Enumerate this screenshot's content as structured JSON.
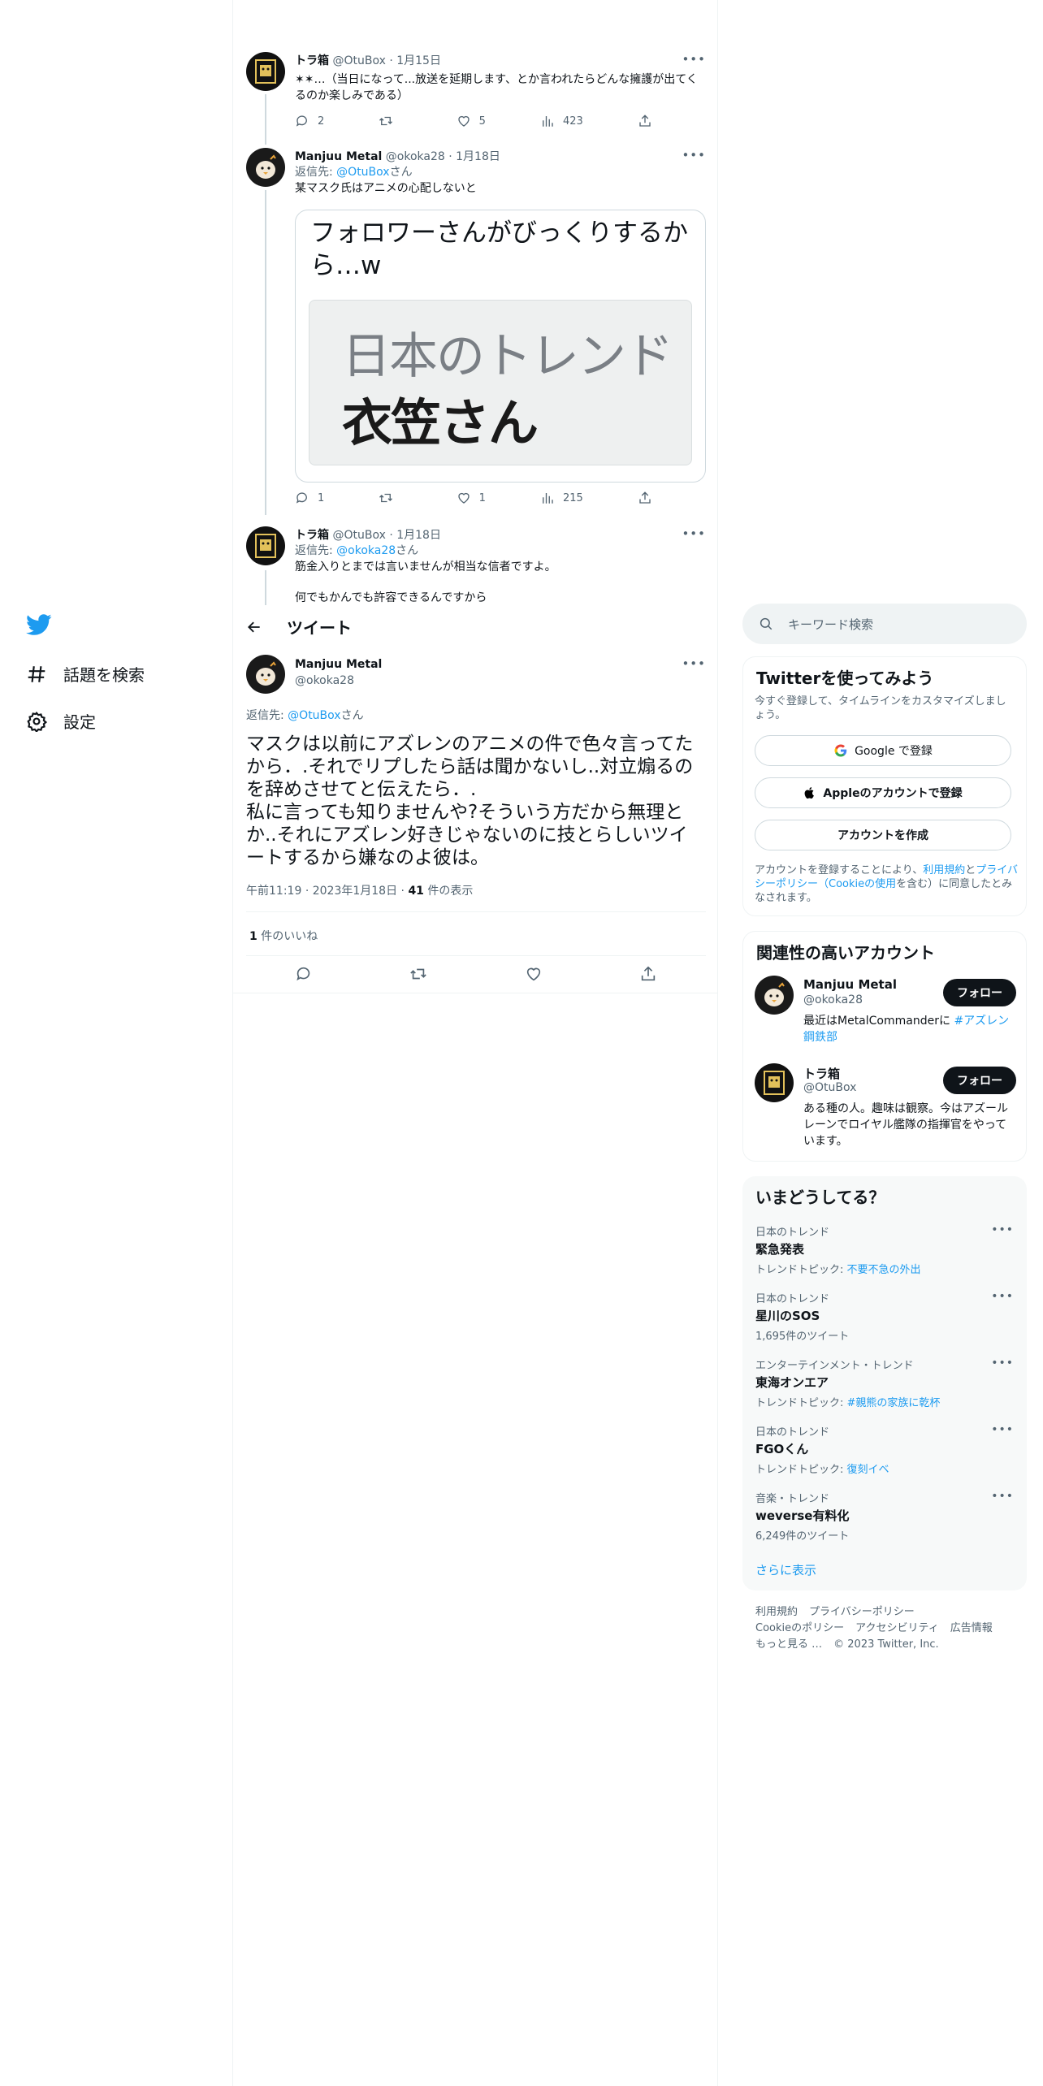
{
  "nav": {
    "explore_label": "話題を検索",
    "settings_label": "設定"
  },
  "thread": [
    {
      "name": "トラ箱",
      "handle": "@OtuBox",
      "date": "1月15日",
      "text": "✶✶…（当日になって...放送を延期します、とか言われたらどんな擁護が出てくるのか楽しみである）",
      "replies": "2",
      "retweets": "",
      "likes": "5",
      "views": "423"
    },
    {
      "name": "Manjuu Metal",
      "handle": "@okoka28",
      "date": "1月18日",
      "reply_prefix": "返信先: ",
      "reply_to": "@OtuBox",
      "reply_suffix": "さん",
      "text": "某マスク氏はアニメの心配しないと",
      "card_text": "フォロワーさんがびっくりするから…w",
      "card_image_line1": "日本のトレンド",
      "card_image_line2": "衣笠さん",
      "replies": "1",
      "retweets": "",
      "likes": "1",
      "views": "215"
    },
    {
      "name": "トラ箱",
      "handle": "@OtuBox",
      "date": "1月18日",
      "reply_prefix": "返信先: ",
      "reply_to": "@okoka28",
      "reply_suffix": "さん",
      "text": "筋金入りとまでは言いませんが相当な信者ですよ。",
      "text2": "何でもかんでも許容できるんですから"
    }
  ],
  "header": {
    "title": "ツイート"
  },
  "main_tweet": {
    "name": "Manjuu Metal",
    "handle": "@okoka28",
    "reply_prefix": "返信先: ",
    "reply_to": "@OtuBox",
    "reply_suffix": "さん",
    "text": "マスクは以前にアズレンのアニメの件で色々言ってたから．.それでリプしたら話は聞かないし..対立煽るのを辞めさせてと伝えたら．.\n私に言っても知りませんや?そういう方だから無理とか..それにアズレン好きじゃないのに技とらしいツイートするから嫌なのよ彼は。",
    "time": "午前11:19",
    "date": "2023年1月18日",
    "views_count": "41",
    "views_label": " 件の表示",
    "likes_count": "1",
    "likes_label": " 件のいいね"
  },
  "search": {
    "placeholder": "キーワード検索"
  },
  "signup": {
    "title": "Twitterを使ってみよう",
    "subtitle": "今すぐ登録して、タイムラインをカスタマイズしましょう。",
    "google_label": "Google で登録",
    "apple_label": "Appleのアカウントで登録",
    "create_label": "アカウントを作成",
    "terms_1": "アカウントを登録することにより、",
    "terms_link1": "利用規約",
    "terms_2": "と",
    "terms_link2": "プライバシーポリシー（Cookieの使用",
    "terms_3": "を含む）に同意したとみなされます。"
  },
  "related": {
    "title": "関連性の高いアカウント",
    "follow_label": "フォロー",
    "accounts": [
      {
        "name": "Manjuu Metal",
        "handle": "@okoka28",
        "bio": "最近はMetalCommanderに ",
        "bio_link": "#アズレン鋼鉄部"
      },
      {
        "name": "トラ箱",
        "handle": "@OtuBox",
        "bio": "ある種の人。趣味は観察。今はアズールレーンでロイヤル艦隊の指揮官をやっています。",
        "bio_link": ""
      }
    ]
  },
  "trends": {
    "title": "いまどうしてる？",
    "items": [
      {
        "meta": "日本のトレンド",
        "title": "緊急発表",
        "sub_prefix": "トレンドトピック: ",
        "sub_link": "不要不急の外出",
        "sub": ""
      },
      {
        "meta": "日本のトレンド",
        "title": "星川のSOS",
        "sub_prefix": "",
        "sub_link": "",
        "sub": "1,695件のツイート"
      },
      {
        "meta": "エンターテインメント・トレンド",
        "title": "東海オンエア",
        "sub_prefix": "トレンドトピック: ",
        "sub_link": "#親熊の家族に乾杯",
        "sub": ""
      },
      {
        "meta": "日本のトレンド",
        "title": "FGOくん",
        "sub_prefix": "トレンドトピック: ",
        "sub_link": "復刻イベ",
        "sub": ""
      },
      {
        "meta": "音楽・トレンド",
        "title": "weverse有料化",
        "sub_prefix": "",
        "sub_link": "",
        "sub": "6,249件のツイート"
      }
    ],
    "show_more": "さらに表示"
  },
  "footer": {
    "terms": "利用規約",
    "privacy": "プライバシーポリシー",
    "cookie": "Cookieのポリシー",
    "accessibility": "アクセシビリティ",
    "ads": "広告情報",
    "more": "もっと見る …",
    "copyright": "© 2023 Twitter, Inc."
  }
}
